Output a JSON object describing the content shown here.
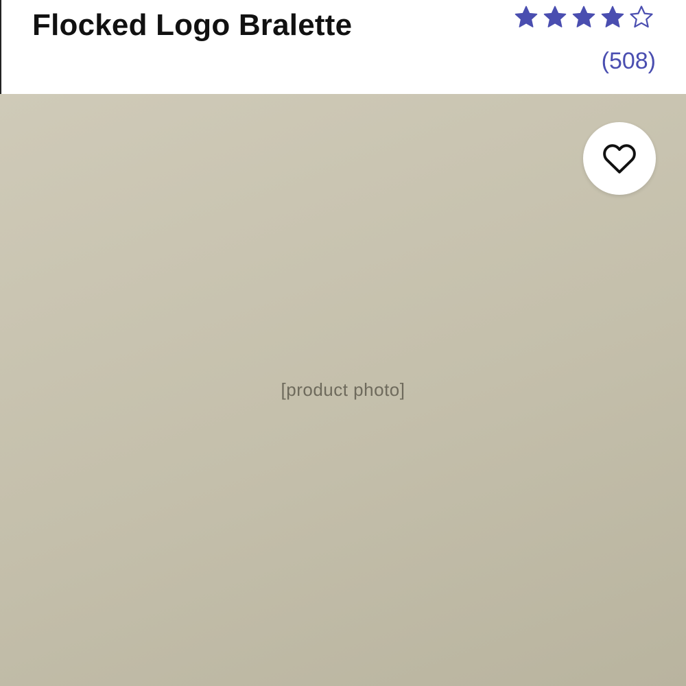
{
  "product": {
    "title": "Flocked Logo Bralette",
    "rating": {
      "value": 4,
      "max": 5,
      "review_count": "(508)"
    }
  },
  "colors": {
    "star": "#4a4eb0",
    "review_count": "#4a4eb0",
    "photo_background": "#c8c3b0"
  },
  "icons": {
    "filled_star": "star-filled-icon",
    "empty_star": "star-outline-icon",
    "favorite": "heart-outline-icon"
  }
}
